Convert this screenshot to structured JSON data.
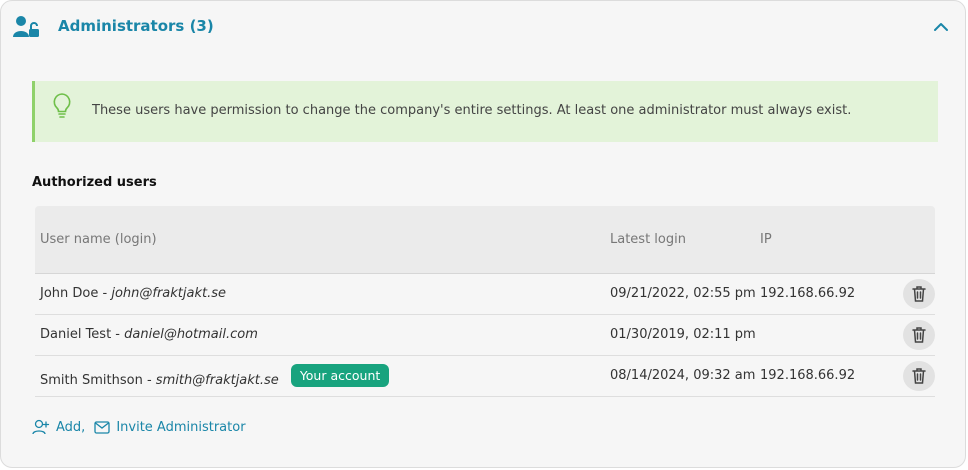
{
  "header": {
    "title": "Administrators (3)",
    "icon": "admin-lock-icon",
    "collapse_icon": "chevron-up-icon",
    "accent": "#1a86a8"
  },
  "notice": {
    "icon": "lightbulb-icon",
    "text": "These users have permission to change the company's entire settings. At least one administrator must always exist."
  },
  "section": {
    "title": "Authorized users"
  },
  "table": {
    "columns": [
      "User name (login)",
      "Latest login",
      "IP"
    ],
    "rows": [
      {
        "name": "John Doe",
        "sep": " - ",
        "email": "john@fraktjakt.se",
        "latest_login": "09/21/2022, 02:55 pm",
        "ip": "192.168.66.92",
        "badge": ""
      },
      {
        "name": "Daniel Test",
        "sep": " - ",
        "email": "daniel@hotmail.com",
        "latest_login": "01/30/2019, 02:11 pm",
        "ip": "",
        "badge": ""
      },
      {
        "name": "Smith Smithson",
        "sep": " - ",
        "email": "smith@fraktjakt.se",
        "latest_login": "08/14/2024, 09:32 am",
        "ip": "192.168.66.92",
        "badge": "Your account"
      }
    ]
  },
  "footer": {
    "add_label": "Add,",
    "invite_label": "Invite Administrator"
  }
}
